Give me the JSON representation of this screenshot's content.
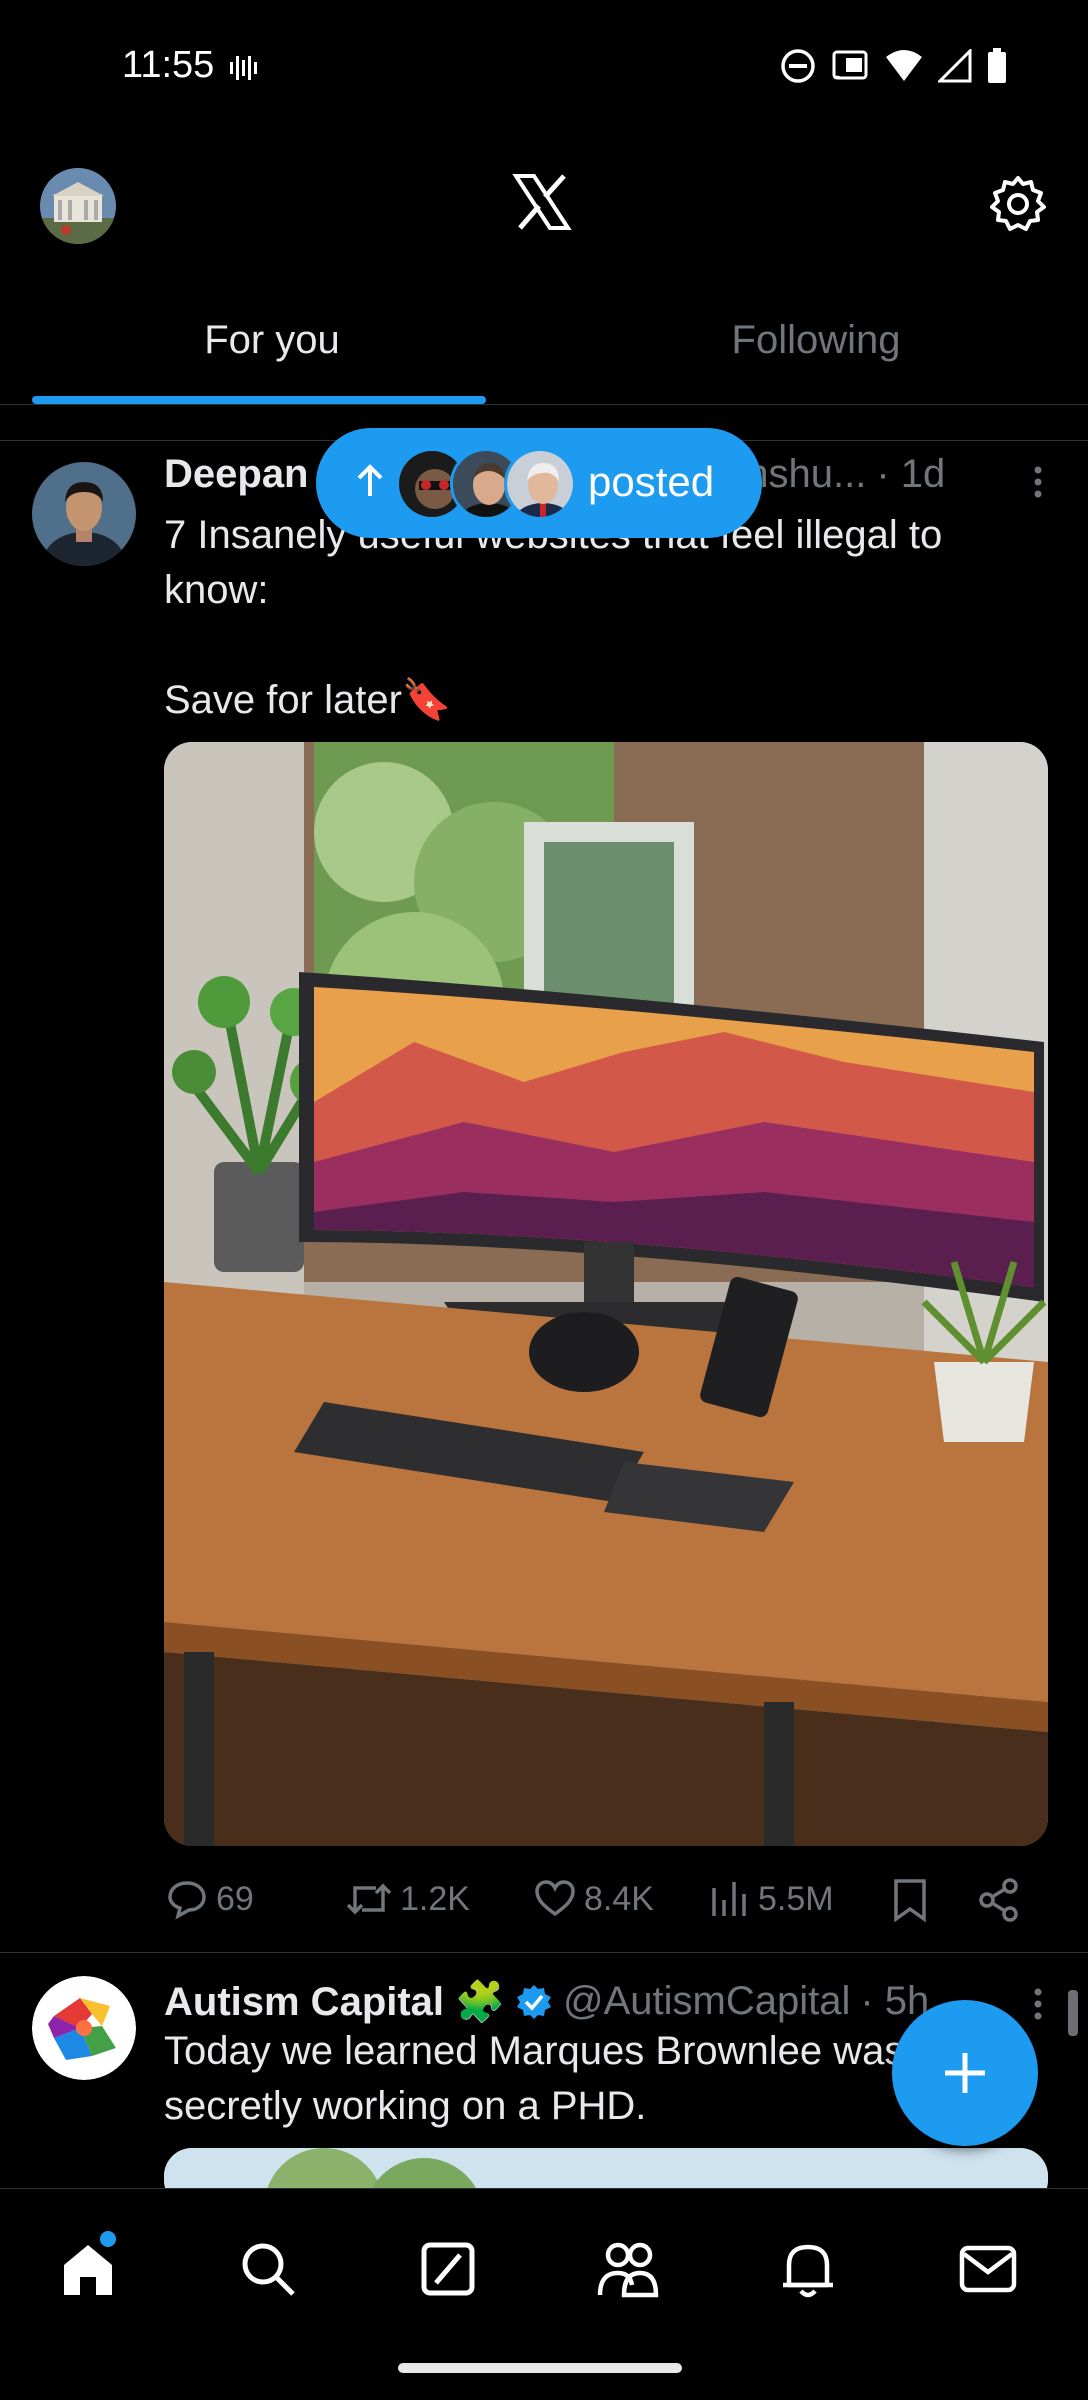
{
  "status_bar": {
    "time": "11:55"
  },
  "tabs": [
    {
      "label": "For you",
      "active": true
    },
    {
      "label": "Following",
      "active": false
    }
  ],
  "new_posts_pill": {
    "label": "posted"
  },
  "tweets": [
    {
      "name": "Deepan",
      "handle": "anshu...",
      "time": "· 1d",
      "text": "7 Insanely useful websites that feel illegal to know:\n\nSave for later🔖",
      "stats": {
        "replies": "69",
        "reposts": "1.2K",
        "likes": "8.4K",
        "views": "5.5M"
      }
    },
    {
      "name": "Autism Capital 🧩",
      "handle": "@AutismCapital",
      "time": "· 5h",
      "text": "Today we learned Marques Brownlee was\nsecretly working on a PHD."
    }
  ],
  "colors": {
    "accent": "#1d9bf0",
    "background": "#000000",
    "muted": "#71767b",
    "text": "#e7e9ea"
  },
  "bottom_nav": [
    "home-icon",
    "search-icon",
    "grok-icon",
    "communities-icon",
    "notifications-icon",
    "messages-icon"
  ]
}
